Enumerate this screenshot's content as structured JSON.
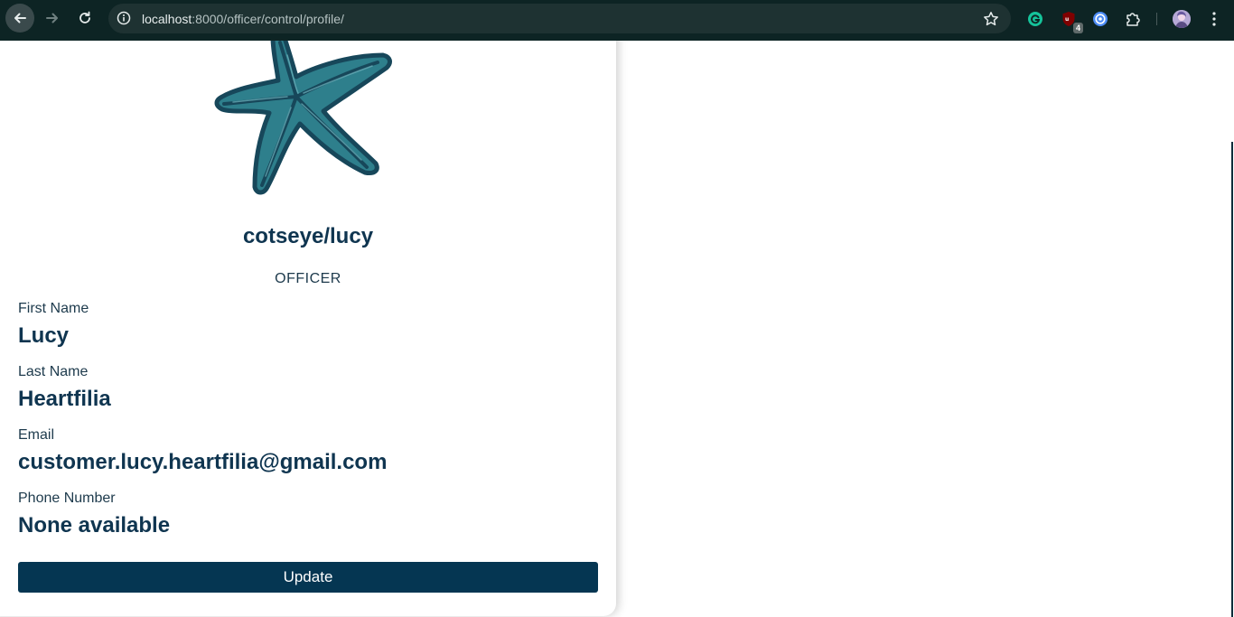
{
  "browser": {
    "url_host": "localhost",
    "url_rest": ":8000/officer/control/profile/",
    "extension_badge": "4",
    "icons": {
      "back": "back-arrow-icon",
      "forward": "forward-arrow-icon",
      "reload": "reload-icon",
      "site_info": "site-info-icon",
      "bookmark": "star-icon",
      "grammarly": "grammarly-icon",
      "ublock": "ublock-icon",
      "extension": "circle-extension-icon",
      "extensions": "puzzle-icon",
      "profile": "profile-avatar",
      "menu": "kebab-menu-icon"
    }
  },
  "profile": {
    "username": "cotseye/lucy",
    "role": "OFFICER",
    "fields": [
      {
        "label": "First Name",
        "value": "Lucy"
      },
      {
        "label": "Last Name",
        "value": "Heartfilia"
      },
      {
        "label": "Email",
        "value": "customer.lucy.heartfilia@gmail.com"
      },
      {
        "label": "Phone Number",
        "value": "None available"
      }
    ],
    "update_label": "Update",
    "logo": "starfish-logo"
  },
  "colors": {
    "accent": "#053652",
    "text_dark": "#0f3550",
    "logo_fill": "#2e7f8c",
    "logo_stroke": "#17475a"
  }
}
